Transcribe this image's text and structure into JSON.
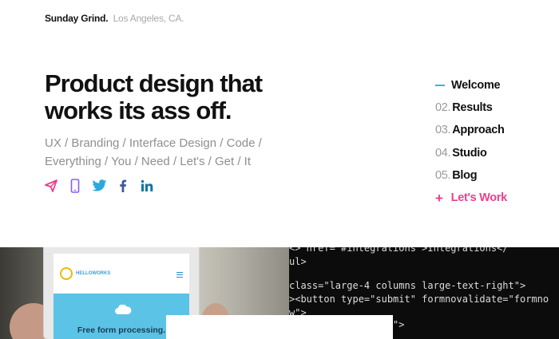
{
  "brand": {
    "name": "Sunday Grind.",
    "location": "Los Angeles, CA."
  },
  "hero": {
    "headline_line1": "Product design that",
    "headline_line2": "works its ass off.",
    "tags_line1": "UX / Branding / Interface Design / Code /",
    "tags_line2": "Everything / You / Need / Let's / Get / It"
  },
  "social": [
    {
      "icon": "paper-plane-icon",
      "color": "#ec3e8e"
    },
    {
      "icon": "mobile-phone-icon",
      "color": "#8b5cf6"
    },
    {
      "icon": "twitter-icon",
      "color": "#2aa9e0"
    },
    {
      "icon": "facebook-icon",
      "color": "#3b5998"
    },
    {
      "icon": "linkedin-icon",
      "color": "#0e76a8"
    }
  ],
  "nav": {
    "welcome": "Welcome",
    "results_num": "02.",
    "results": "Results",
    "approach_num": "03.",
    "approach": "Approach",
    "studio_num": "04.",
    "studio": "Studio",
    "blog_num": "05.",
    "blog": "Blog",
    "work_symbol": "+",
    "work": "Let's Work"
  },
  "phone_screen": {
    "logo_text": "HELLOWORKS",
    "hero_text": "Free form processing."
  },
  "code_lines": [
    "<> href=\"#integrations\">Integrations</",
    "ul>",
    "",
    "class=\"large-4 columns large-text-right\">",
    "><button type=\"submit\" formnovalidate=\"formno",
    "w\">",
    "                  \">"
  ],
  "colors": {
    "accent_pink": "#ec3e8e",
    "accent_blue": "#2db8f0"
  }
}
